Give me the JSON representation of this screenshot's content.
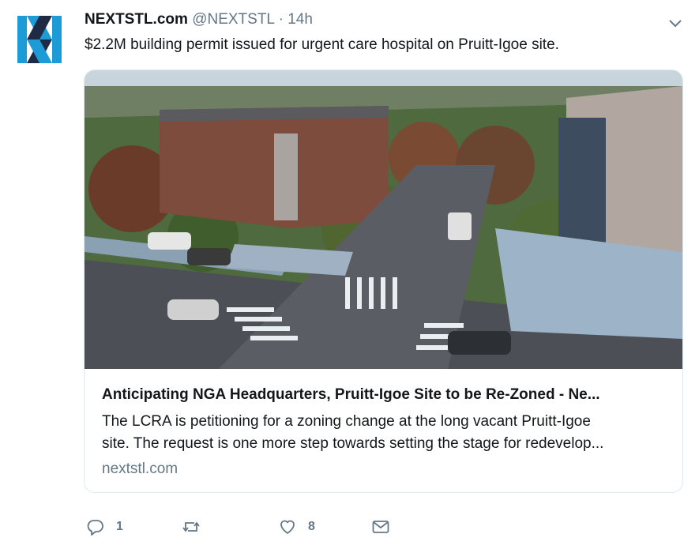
{
  "tweet": {
    "author_name": "NEXTSTL.com",
    "author_handle": "@NEXTSTL",
    "separator": "·",
    "time": "14h",
    "text": "$2.2M building permit issued for urgent care hospital on Pruitt-Igoe site."
  },
  "card": {
    "title": "Anticipating NGA Headquarters, Pruitt-Igoe Site to be Re-Zoned - Ne...",
    "description_lines": [
      "The LCRA is petitioning for a zoning change at the long vacant Pruitt-Igoe",
      "site. The request is one more step towards setting the stage for redevelop..."
    ],
    "domain": "nextstl.com"
  },
  "actions": {
    "reply_count": "1",
    "retweet_count": "",
    "like_count": "8"
  },
  "colors": {
    "text": "#14171a",
    "secondary": "#657786",
    "border": "#e1e8ed",
    "logo_blue": "#1d9bd7",
    "logo_dark": "#1f2a44"
  },
  "icons": [
    "nextstl-logo",
    "chevron-down-icon",
    "reply-icon",
    "retweet-icon",
    "like-icon",
    "message-icon"
  ]
}
